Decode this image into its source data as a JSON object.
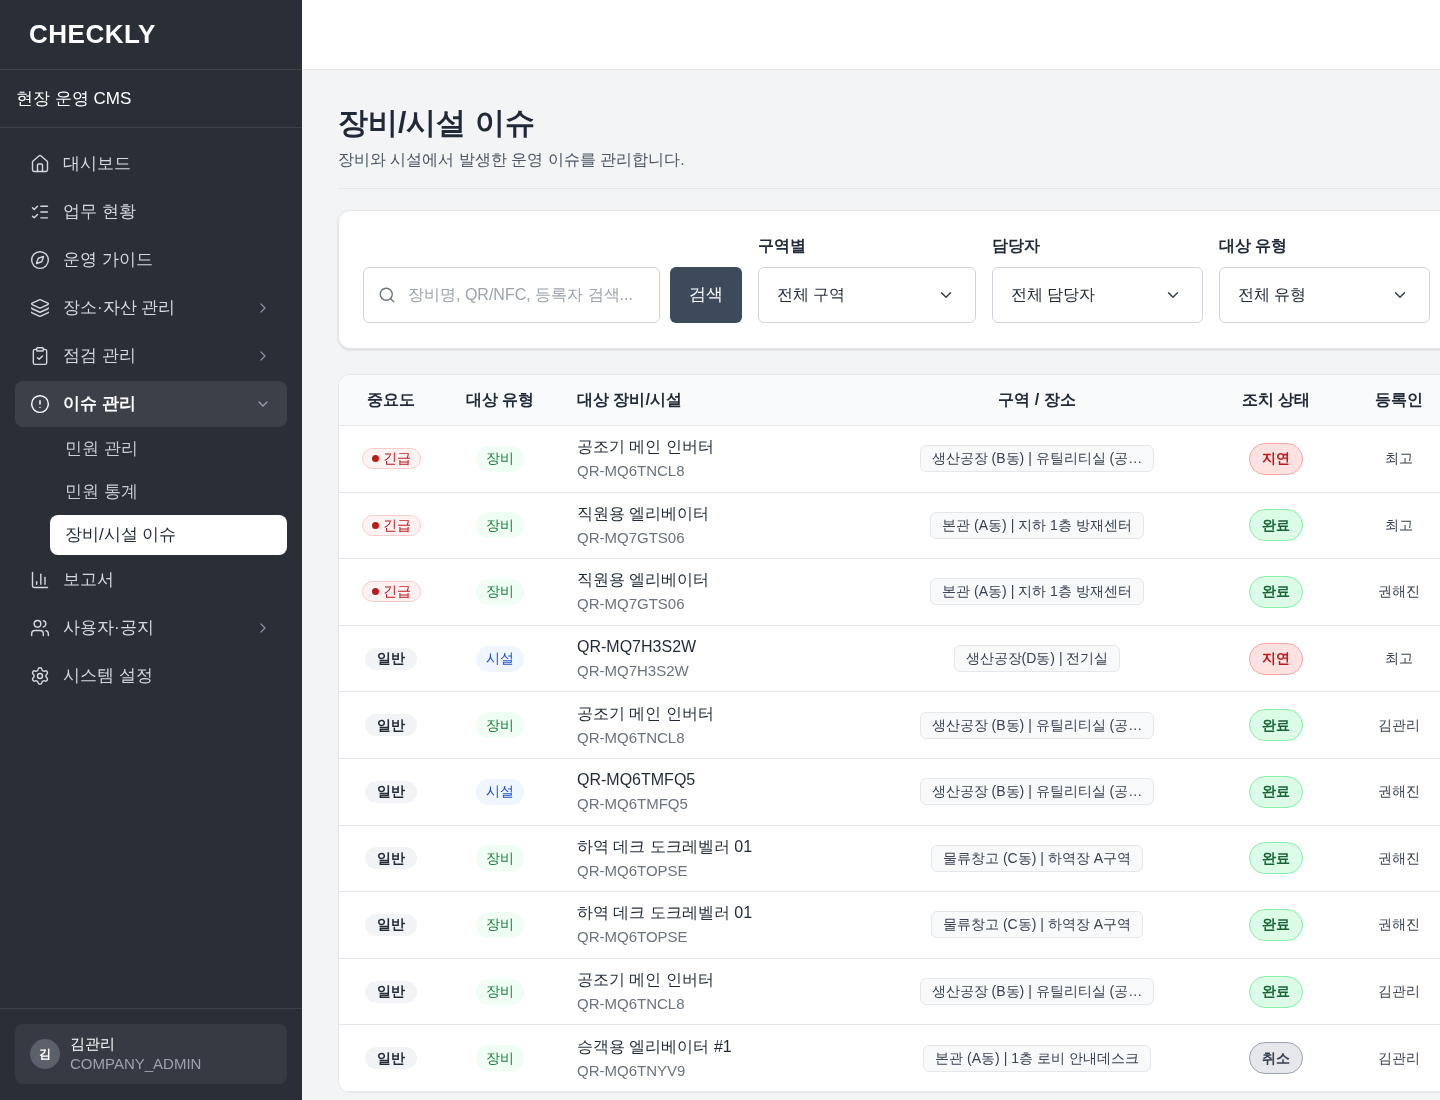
{
  "sidebar": {
    "logo": "CHECKLY",
    "workspace": "현장 운영 CMS",
    "nav": [
      {
        "label": "대시보드",
        "selected": false
      },
      {
        "label": "업무 현황",
        "selected": false
      },
      {
        "label": "운영 가이드",
        "selected": false
      },
      {
        "label": "장소·자산 관리",
        "selected": false,
        "expanded": false
      },
      {
        "label": "점검 관리",
        "selected": false,
        "expanded": false
      },
      {
        "label": "이슈 관리",
        "selected": true,
        "expanded": true,
        "children": [
          {
            "label": "민원 관리",
            "selected": false
          },
          {
            "label": "민원 통계",
            "selected": false
          },
          {
            "label": "장비/시설 이슈",
            "selected": true
          }
        ]
      },
      {
        "label": "보고서",
        "selected": false
      },
      {
        "label": "사용자·공지",
        "selected": false,
        "expanded": false
      },
      {
        "label": "시스템 설정",
        "selected": false
      }
    ],
    "user": {
      "avatar_initial": "김",
      "name": "김관리",
      "role": "COMPANY_ADMIN"
    }
  },
  "page": {
    "title": "장비/시설 이슈",
    "subtitle": "장비와 시설에서 발생한 운영 이슈를 관리합니다."
  },
  "filters": {
    "search": {
      "placeholder": "장비명, QR/NFC, 등록자 검색..."
    },
    "search_button": "검색",
    "selects": [
      {
        "label": "구역별",
        "value": "전체 구역"
      },
      {
        "label": "담당자",
        "value": "전체 담당자"
      },
      {
        "label": "대상 유형",
        "value": "전체 유형"
      }
    ]
  },
  "table": {
    "columns": [
      "중요도",
      "대상 유형",
      "대상 장비/시설",
      "구역 / 장소",
      "조치 상태",
      "등록인"
    ],
    "rows": [
      {
        "severity": {
          "label": "긴급",
          "kind": "urgent"
        },
        "target_type": {
          "label": "장비",
          "kind": "equipment"
        },
        "target_name": "공조기 메인 인버터",
        "target_code": "QR-MQ6TNCL8",
        "location": "생산공장 (B동) | 유틸리티실 (공…",
        "status": {
          "label": "지연",
          "kind": "delayed"
        },
        "registrant": "최고"
      },
      {
        "severity": {
          "label": "긴급",
          "kind": "urgent"
        },
        "target_type": {
          "label": "장비",
          "kind": "equipment"
        },
        "target_name": "직원용 엘리베이터",
        "target_code": "QR-MQ7GTS06",
        "location": "본관 (A동) | 지하 1층 방재센터",
        "status": {
          "label": "완료",
          "kind": "done"
        },
        "registrant": "최고"
      },
      {
        "severity": {
          "label": "긴급",
          "kind": "urgent"
        },
        "target_type": {
          "label": "장비",
          "kind": "equipment"
        },
        "target_name": "직원용 엘리베이터",
        "target_code": "QR-MQ7GTS06",
        "location": "본관 (A동) | 지하 1층 방재센터",
        "status": {
          "label": "완료",
          "kind": "done"
        },
        "registrant": "권해진"
      },
      {
        "severity": {
          "label": "일반",
          "kind": "normal"
        },
        "target_type": {
          "label": "시설",
          "kind": "facility"
        },
        "target_name": "QR-MQ7H3S2W",
        "target_code": "QR-MQ7H3S2W",
        "location": "생산공장(D동) | 전기실",
        "status": {
          "label": "지연",
          "kind": "delayed"
        },
        "registrant": "최고"
      },
      {
        "severity": {
          "label": "일반",
          "kind": "normal"
        },
        "target_type": {
          "label": "장비",
          "kind": "equipment"
        },
        "target_name": "공조기 메인 인버터",
        "target_code": "QR-MQ6TNCL8",
        "location": "생산공장 (B동) | 유틸리티실 (공…",
        "status": {
          "label": "완료",
          "kind": "done"
        },
        "registrant": "김관리"
      },
      {
        "severity": {
          "label": "일반",
          "kind": "normal"
        },
        "target_type": {
          "label": "시설",
          "kind": "facility"
        },
        "target_name": "QR-MQ6TMFQ5",
        "target_code": "QR-MQ6TMFQ5",
        "location": "생산공장 (B동) | 유틸리티실 (공…",
        "status": {
          "label": "완료",
          "kind": "done"
        },
        "registrant": "권해진"
      },
      {
        "severity": {
          "label": "일반",
          "kind": "normal"
        },
        "target_type": {
          "label": "장비",
          "kind": "equipment"
        },
        "target_name": "하역 데크 도크레벨러 01",
        "target_code": "QR-MQ6TOPSE",
        "location": "물류창고 (C동) | 하역장 A구역",
        "status": {
          "label": "완료",
          "kind": "done"
        },
        "registrant": "권해진"
      },
      {
        "severity": {
          "label": "일반",
          "kind": "normal"
        },
        "target_type": {
          "label": "장비",
          "kind": "equipment"
        },
        "target_name": "하역 데크 도크레벨러 01",
        "target_code": "QR-MQ6TOPSE",
        "location": "물류창고 (C동) | 하역장 A구역",
        "status": {
          "label": "완료",
          "kind": "done"
        },
        "registrant": "권해진"
      },
      {
        "severity": {
          "label": "일반",
          "kind": "normal"
        },
        "target_type": {
          "label": "장비",
          "kind": "equipment"
        },
        "target_name": "공조기 메인 인버터",
        "target_code": "QR-MQ6TNCL8",
        "location": "생산공장 (B동) | 유틸리티실 (공…",
        "status": {
          "label": "완료",
          "kind": "done"
        },
        "registrant": "김관리"
      },
      {
        "severity": {
          "label": "일반",
          "kind": "normal"
        },
        "target_type": {
          "label": "장비",
          "kind": "equipment"
        },
        "target_name": "승객용 엘리베이터 #1",
        "target_code": "QR-MQ6TNYV9",
        "location": "본관 (A동) | 1층 로비 안내데스크",
        "status": {
          "label": "취소",
          "kind": "cancelled"
        },
        "registrant": "김관리"
      }
    ]
  }
}
